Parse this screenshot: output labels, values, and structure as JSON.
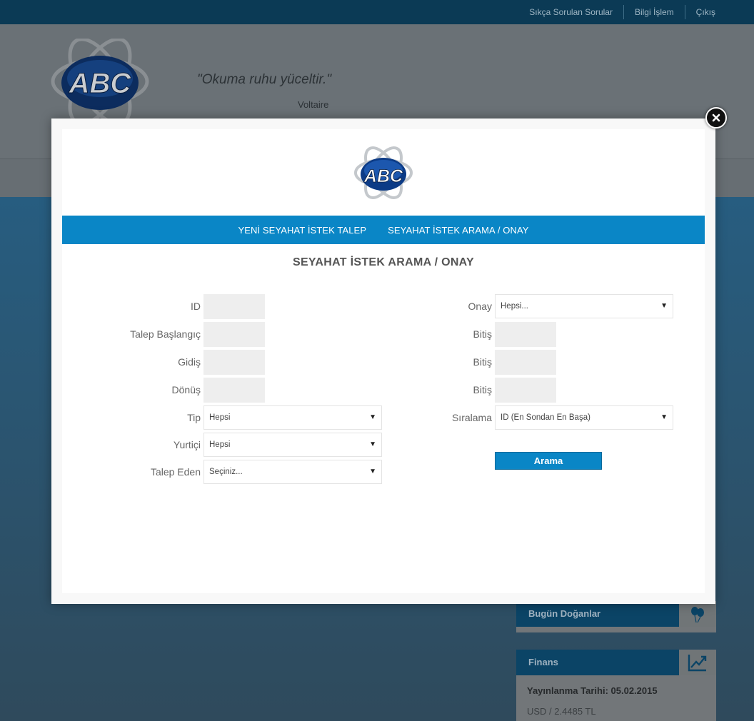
{
  "topbar": {
    "links": [
      "Sıkça Sorulan Sorular",
      "Bilgi İşlem",
      "Çıkış"
    ]
  },
  "header": {
    "quote": "\"Okuma ruhu yüceltir.\"",
    "author": "Voltaire",
    "logo_text": "ABC"
  },
  "widgets": {
    "birthdays": {
      "title": "Bugün Doğanlar",
      "icon": "balloons-icon"
    },
    "finance": {
      "title": "Finans",
      "icon": "chart-up-icon",
      "date_line": "Yayınlanma Tarihi: 05.02.2015",
      "rate_line": "USD / 2.4485 TL"
    }
  },
  "modal": {
    "logo_text": "ABC",
    "tabs": [
      "YENİ SEYAHAT İSTEK TALEP",
      "SEYAHAT İSTEK ARAMA / ONAY"
    ],
    "title": "SEYAHAT İSTEK ARAMA / ONAY",
    "form": {
      "id_label": "ID",
      "talep_baslangic_label": "Talep Başlangıç",
      "gidis_label": "Gidiş",
      "donus_label": "Dönüş",
      "tip_label": "Tip",
      "tip_value": "Hepsi",
      "yurtici_label": "Yurtiçi",
      "yurtici_value": "Hepsi",
      "talep_eden_label": "Talep Eden",
      "talep_eden_value": "Seçiniz...",
      "onay_label": "Onay",
      "onay_value": "Hepsi...",
      "bitis_label": "Bitiş",
      "siralama_label": "Sıralama",
      "siralama_value": "ID (En Sondan En Başa)",
      "search_label": "Arama"
    }
  },
  "colors": {
    "accent": "#0a86c6",
    "topbar": "#0b3a55"
  }
}
